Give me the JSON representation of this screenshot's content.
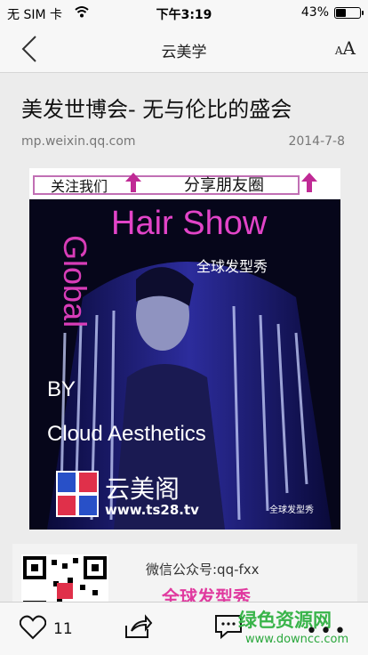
{
  "status": {
    "carrier": "无 SIM 卡",
    "time": "下午3:19",
    "battery": "43%",
    "battery_level": 0.43
  },
  "nav": {
    "title": "云美学",
    "font_small": "A",
    "font_big": "A"
  },
  "article": {
    "headline": "美发世博会- 无与伦比的盛会",
    "source": "mp.weixin.qq.com",
    "date": "2014-7-8",
    "banner": {
      "follow": "关注我们",
      "share": "分享朋友圈"
    },
    "poster": {
      "hair_show": "Hair Show",
      "sub": "全球发型秀",
      "global": "Global",
      "by": "BY",
      "cloud": "Cloud Aesthetics",
      "brand": "云美阁",
      "url": "www.ts28.tv",
      "watermark": "全球发型秀"
    },
    "card": {
      "account": "微信公众号:qq-fxx",
      "show": "全球发型秀"
    }
  },
  "toolbar": {
    "likes": "11",
    "more": "•••",
    "watermark": "绿色资源网",
    "watermark_url": "www.downcc.com"
  },
  "colors": {
    "accent_pink": "#e244c8",
    "watermark_green": "#39b44a"
  }
}
